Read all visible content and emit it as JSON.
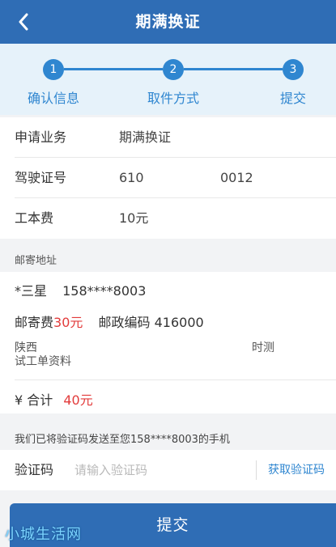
{
  "navbar": {
    "title": "期满换证"
  },
  "steps": [
    {
      "num": "1",
      "label": "确认信息"
    },
    {
      "num": "2",
      "label": "取件方式"
    },
    {
      "num": "3",
      "label": "提交"
    }
  ],
  "info": {
    "business_label": "申请业务",
    "business_value": "期满换证",
    "license_label": "驾驶证号",
    "license_value_a": "610",
    "license_value_b": "0012",
    "fee_label": "工本费",
    "fee_value": "10元"
  },
  "mail": {
    "section_title": "邮寄地址",
    "recipient": "*三星",
    "phone": "158****8003",
    "postage_label": "邮寄费",
    "postage_value": "30元",
    "postcode_label": "邮政编码",
    "postcode_value": "416000",
    "address_line1": "陕西",
    "address_line1_tail": "时测",
    "address_line2": "试工单资料",
    "total_label": "¥ 合计",
    "total_value": "40元"
  },
  "verification": {
    "notice": "我们已将验证码发送至您158****8003的手机",
    "label": "验证码",
    "placeholder": "请输入验证码",
    "get_code": "获取验证码"
  },
  "submit": {
    "label": "提交"
  },
  "watermark": "小城生活网",
  "colors": {
    "primary": "#2f6db5",
    "accent": "#2f86d0",
    "price": "#e23b3b"
  }
}
